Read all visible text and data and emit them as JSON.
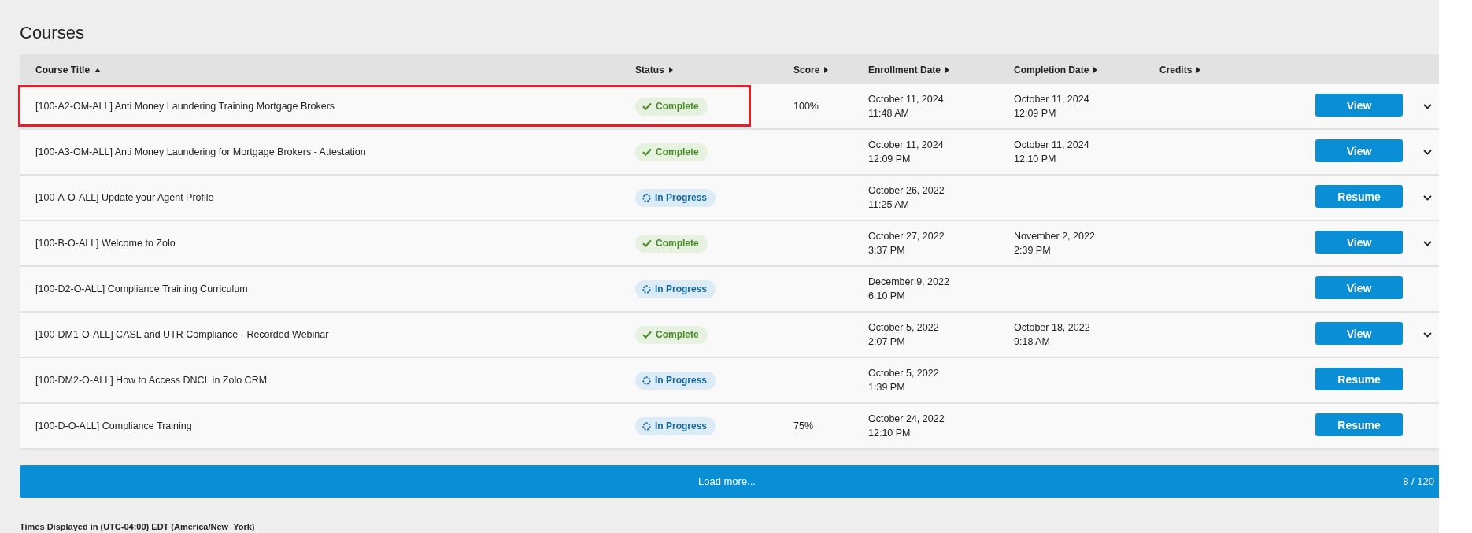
{
  "page": {
    "title": "Courses"
  },
  "table": {
    "columns": [
      {
        "label": "Course Title",
        "sorted": true
      },
      {
        "label": "Status",
        "sorted": false
      },
      {
        "label": "Score",
        "sorted": false
      },
      {
        "label": "Enrollment Date",
        "sorted": false
      },
      {
        "label": "Completion Date",
        "sorted": false
      },
      {
        "label": "Credits",
        "sorted": false
      }
    ],
    "rows": [
      {
        "title": "[100-A2-OM-ALL] Anti Money Laundering Training Mortgage Brokers",
        "status": {
          "label": "Complete",
          "kind": "complete"
        },
        "score": "100%",
        "enrollment": {
          "date": "October 11, 2024",
          "time": "11:48 AM"
        },
        "completion": {
          "date": "October 11, 2024",
          "time": "12:09 PM"
        },
        "action": "View",
        "expandable": true,
        "highlighted": true
      },
      {
        "title": "[100-A3-OM-ALL] Anti Money Laundering for Mortgage Brokers - Attestation",
        "status": {
          "label": "Complete",
          "kind": "complete"
        },
        "enrollment": {
          "date": "October 11, 2024",
          "time": "12:09 PM"
        },
        "completion": {
          "date": "October 11, 2024",
          "time": "12:10 PM"
        },
        "action": "View",
        "expandable": true,
        "highlighted": false
      },
      {
        "title": "[100-A-O-ALL] Update your Agent Profile",
        "status": {
          "label": "In Progress",
          "kind": "in_progress"
        },
        "enrollment": {
          "date": "October 26, 2022",
          "time": "11:25 AM"
        },
        "action": "Resume",
        "expandable": true,
        "highlighted": false
      },
      {
        "title": "[100-B-O-ALL] Welcome to Zolo",
        "status": {
          "label": "Complete",
          "kind": "complete"
        },
        "enrollment": {
          "date": "October 27, 2022",
          "time": "3:37 PM"
        },
        "completion": {
          "date": "November 2, 2022",
          "time": "2:39 PM"
        },
        "action": "View",
        "expandable": true,
        "highlighted": false
      },
      {
        "title": "[100-D2-O-ALL] Compliance Training Curriculum",
        "status": {
          "label": "In Progress",
          "kind": "in_progress"
        },
        "enrollment": {
          "date": "December 9, 2022",
          "time": "6:10 PM"
        },
        "action": "View",
        "expandable": false,
        "highlighted": false
      },
      {
        "title": "[100-DM1-O-ALL] CASL and UTR Compliance - Recorded Webinar",
        "status": {
          "label": "Complete",
          "kind": "complete"
        },
        "enrollment": {
          "date": "October 5, 2022",
          "time": "2:07 PM"
        },
        "completion": {
          "date": "October 18, 2022",
          "time": "9:18 AM"
        },
        "action": "View",
        "expandable": true,
        "highlighted": false
      },
      {
        "title": "[100-DM2-O-ALL] How to Access DNCL in Zolo CRM",
        "status": {
          "label": "In Progress",
          "kind": "in_progress"
        },
        "enrollment": {
          "date": "October 5, 2022",
          "time": "1:39 PM"
        },
        "action": "Resume",
        "expandable": false,
        "highlighted": false
      },
      {
        "title": "[100-D-O-ALL] Compliance Training",
        "status": {
          "label": "In Progress",
          "kind": "in_progress"
        },
        "score": "75%",
        "enrollment": {
          "date": "October 24, 2022",
          "time": "12:10 PM"
        },
        "action": "Resume",
        "expandable": false,
        "highlighted": false
      }
    ]
  },
  "load_more": {
    "label": "Load more...",
    "count": "8 / 120"
  },
  "footer": {
    "timezone_note": "Times Displayed in (UTC-04:00) EDT (America/New_York)"
  }
}
